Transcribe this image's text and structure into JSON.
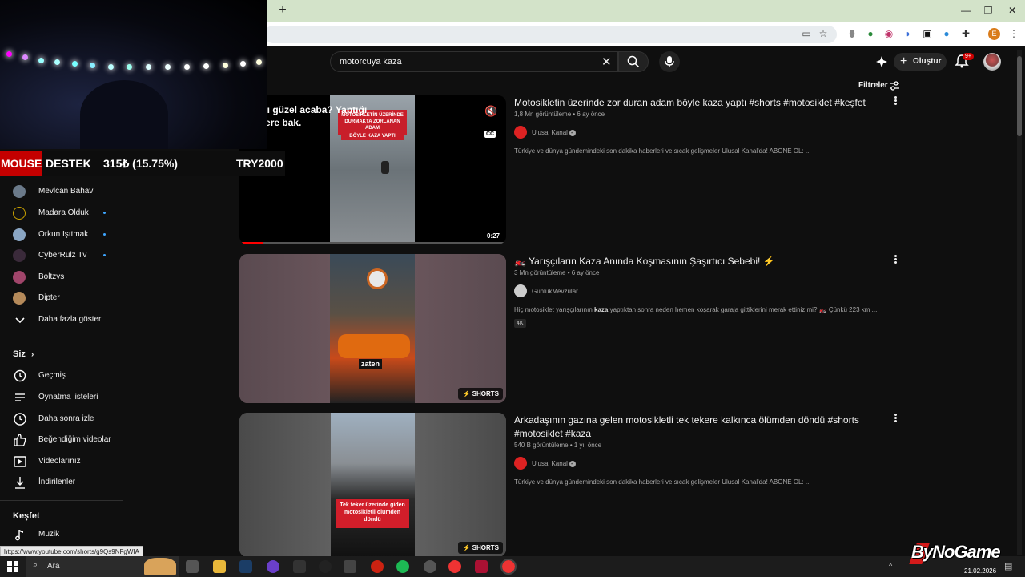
{
  "browser": {
    "new_tab_glyph": "+",
    "profile_initial": "E",
    "window_controls": [
      "—",
      "❐",
      "✕"
    ]
  },
  "header": {
    "search_value": "motorcuya kaza",
    "create_label": "Oluştur",
    "notif_badge": "9+",
    "filters_label": "Filtreler"
  },
  "overlay": {
    "ticker_mouse": "MOUSE",
    "ticker_destek": "DESTEK",
    "ticker_amount": "315₺ (15.75%)",
    "ticker_goal": "TRY2000",
    "caption_line1": "fası mı güzel acaba? Yaptığı",
    "caption_line2": "reketlere bak."
  },
  "sidebar": {
    "subscriptions": [
      {
        "label": "Mevlcan Bahav",
        "dot": false
      },
      {
        "label": "Madara Olduk",
        "dot": true
      },
      {
        "label": "Orkun Işıtmak",
        "dot": true
      },
      {
        "label": "CyberRulz Tv",
        "dot": true
      },
      {
        "label": "Boltzys",
        "dot": false
      },
      {
        "label": "Dipter",
        "dot": false
      }
    ],
    "show_more": "Daha fazla göster",
    "siz_heading": "Siz",
    "siz_items": [
      "Geçmiş",
      "Oynatma listeleri",
      "Daha sonra izle",
      "Beğendiğim videolar",
      "Videolarınız",
      "İndirilenler"
    ],
    "kesfet_heading": "Keşfet",
    "kesfet_items": [
      "Müzik"
    ]
  },
  "results": [
    {
      "title": "Motosikletin üzerinde zor duran adam böyle kaza yaptı #shorts #motosiklet #keşfet",
      "views": "1,8 Mn görüntüleme",
      "age": "6 ay önce",
      "channel": "Ulusal Kanal",
      "description": "Türkiye ve dünya gündemindeki son dakika haberleri ve sıcak gelişmeler Ulusal Kanal'da! ABONE OL: ...",
      "duration": "0:27",
      "thumb_text_1": "MOTOSİKLETİN ÜZERİNDE DURMAKTA ZORLANAN ADAM",
      "thumb_text_2": "BÖYLE KAZA YAPTI",
      "cc_label": "CC"
    },
    {
      "title": "Yarışçıların Kaza Anında Koşmasının Şaşırtıcı Sebebi!",
      "views": "3 Mn görüntüleme",
      "age": "6 ay önce",
      "channel": "GünlükMevzular",
      "description_prefix": "Hiç motosiklet yarışçılarının ",
      "description_bold": "kaza",
      "description_suffix": " yaptıktan sonra neden hemen koşarak garaja gittiklerini merak ettiniz mi? 🏍️ Çünkü 223 km ...",
      "badge": "4K",
      "shorts_label": "SHORTS",
      "thumb_caption": "zaten"
    },
    {
      "title": "Arkadaşının gazına gelen motosikletli tek tekere kalkınca ölümden döndü #shorts #motosiklet #kaza",
      "views": "540 B görüntüleme",
      "age": "1 yıl önce",
      "channel": "Ulusal Kanal",
      "description": "Türkiye ve dünya gündemindeki son dakika haberleri ve sıcak gelişmeler Ulusal Kanal'da! ABONE OL: ...",
      "shorts_label": "SHORTS",
      "thumb_caption": "Tek teker üzerinde giden motosikletli ölümden döndü"
    }
  ],
  "status_url": "https://www.youtube.com/shorts/g9Qs9NFgWIA",
  "taskbar": {
    "search_label": "Ara",
    "date": "21.02.2026"
  },
  "brand_overlay": "ByNoGame",
  "colors": {
    "accent_red": "#cc0000",
    "link_blue": "#3ea6ff"
  }
}
